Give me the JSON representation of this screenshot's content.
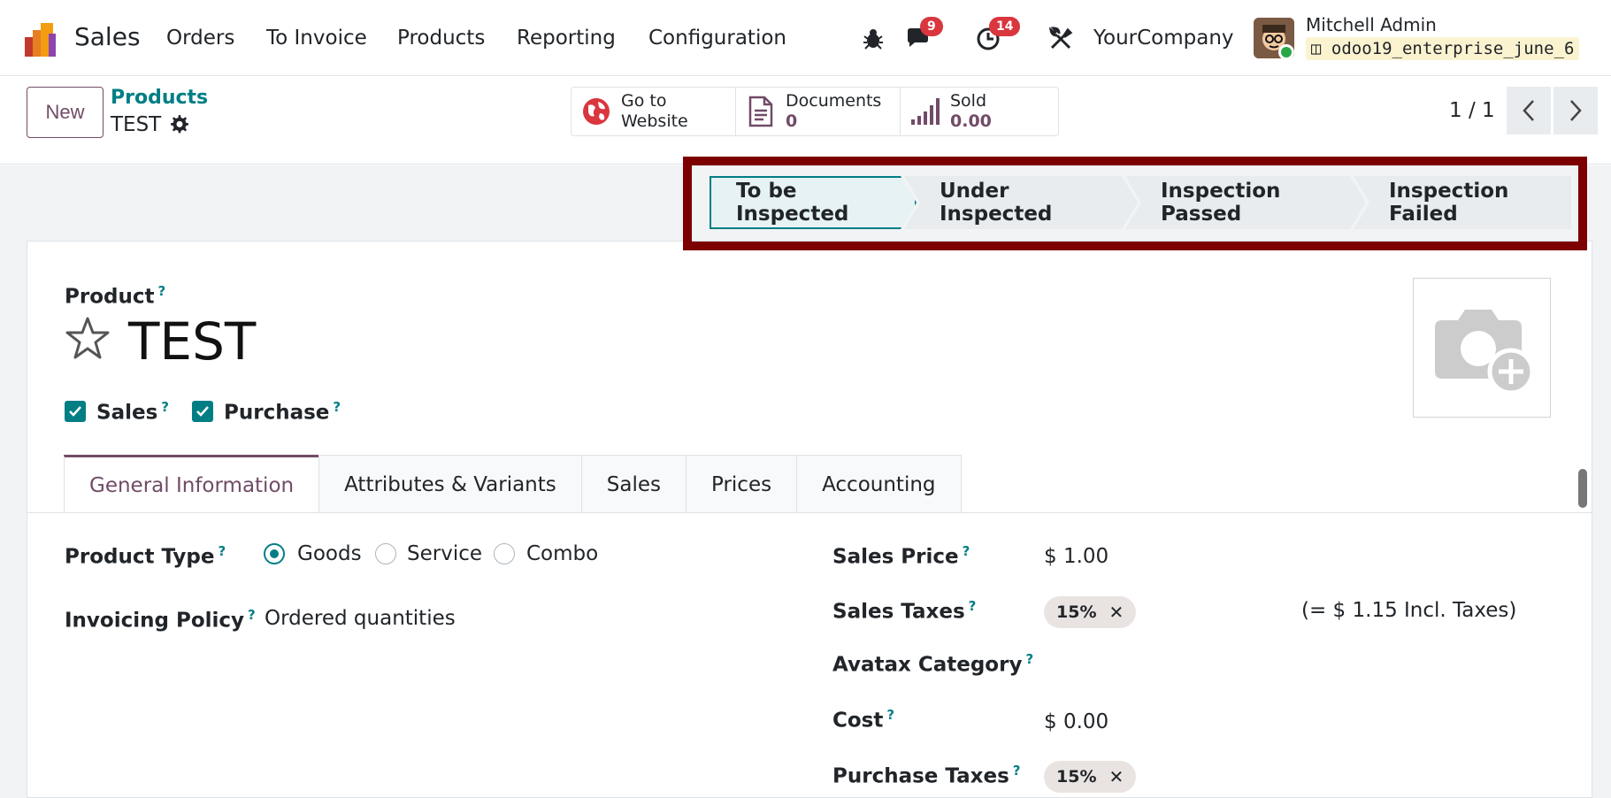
{
  "nav": {
    "app_name": "Sales",
    "menu": [
      "Orders",
      "To Invoice",
      "Products",
      "Reporting",
      "Configuration"
    ],
    "messages_count": "9",
    "activities_count": "14",
    "company": "YourCompany",
    "user_name": "Mitchell Admin",
    "db_name": "odoo19_enterprise_june_6"
  },
  "control": {
    "new_label": "New",
    "breadcrumb_parent": "Products",
    "breadcrumb_current": "TEST",
    "smart_buttons": [
      {
        "label_line1": "Go to",
        "label_line2": "Website",
        "icon": "globe-icon"
      },
      {
        "label_line1": "Documents",
        "value": "0",
        "icon": "document-icon"
      },
      {
        "label_line1": "Sold",
        "value": "0.00",
        "icon": "bar-chart-icon"
      }
    ],
    "pager": "1 / 1"
  },
  "status": {
    "stages": [
      "To be Inspected",
      "Under Inspected",
      "Inspection Passed",
      "Inspection Failed"
    ],
    "current": "To be Inspected"
  },
  "form": {
    "product_label": "Product",
    "title": "TEST",
    "sales_label": "Sales",
    "purchase_label": "Purchase",
    "tabs": [
      "General Information",
      "Attributes & Variants",
      "Sales",
      "Prices",
      "Accounting"
    ],
    "product_type_label": "Product Type",
    "product_type_options": [
      "Goods",
      "Service",
      "Combo"
    ],
    "product_type_selected": "Goods",
    "invoicing_policy_label": "Invoicing Policy",
    "invoicing_policy_value": "Ordered quantities",
    "sales_price_label": "Sales Price",
    "sales_price_value": "$ 1.00",
    "sales_taxes_label": "Sales Taxes",
    "sales_taxes_tag": "15%",
    "incl_taxes_text": "(= $ 1.15 Incl. Taxes)",
    "avatax_label": "Avatax Category",
    "cost_label": "Cost",
    "cost_value": "$ 0.00",
    "purchase_taxes_label": "Purchase Taxes",
    "purchase_taxes_tag": "15%",
    "help_mark": "?"
  },
  "colors": {
    "accent": "#714b67",
    "teal": "#017e84",
    "highlight_frame": "#7c0000"
  }
}
